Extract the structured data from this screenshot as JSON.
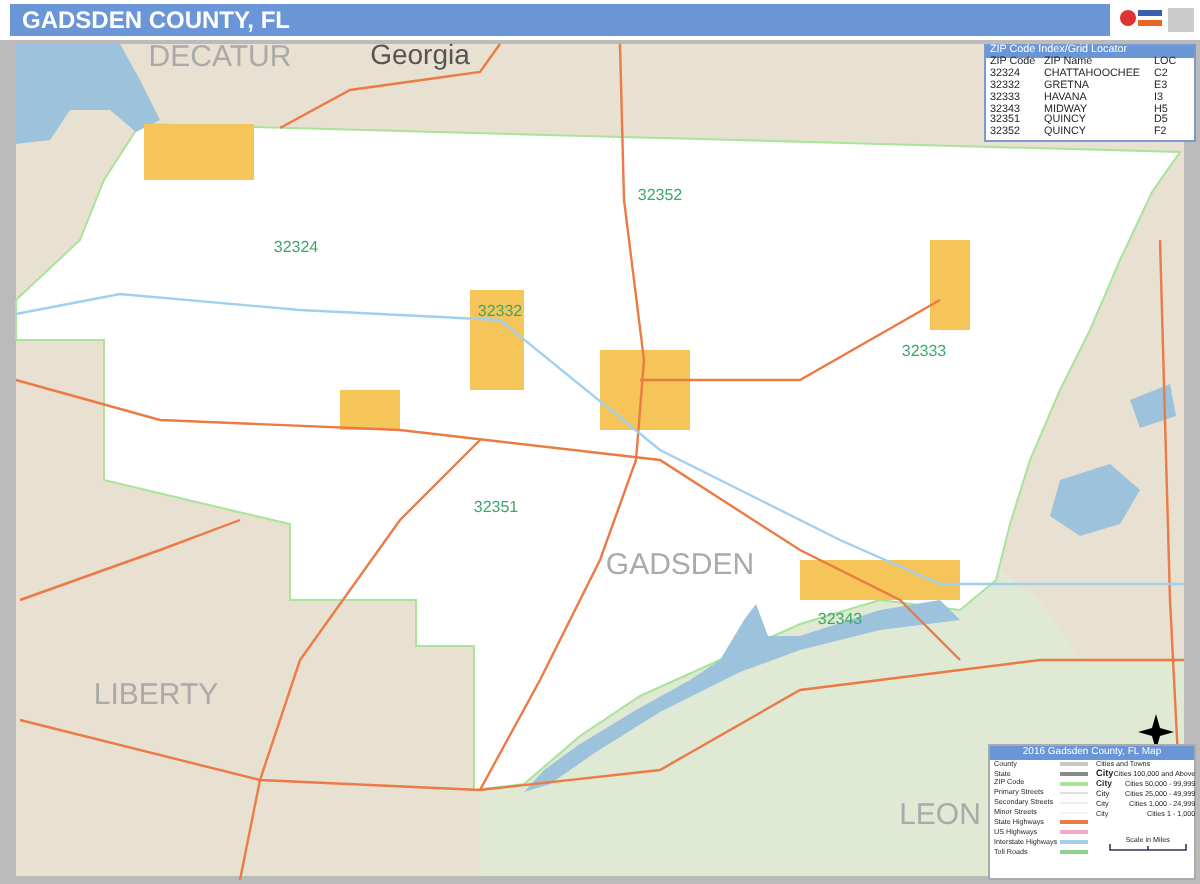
{
  "header": {
    "title": "GADSDEN COUNTY, FL"
  },
  "map_labels": [
    {
      "kind": "county",
      "text": "DECATUR"
    },
    {
      "kind": "state",
      "text": "Georgia"
    },
    {
      "kind": "zip",
      "text": "32352"
    },
    {
      "kind": "zip",
      "text": "32324"
    },
    {
      "kind": "zip",
      "text": "32332"
    },
    {
      "kind": "zip",
      "text": "32333"
    },
    {
      "kind": "zip",
      "text": "32351"
    },
    {
      "kind": "county",
      "text": "GADSDEN"
    },
    {
      "kind": "zip",
      "text": "32343"
    },
    {
      "kind": "county",
      "text": "LIBERTY"
    },
    {
      "kind": "county",
      "text": "LEON"
    }
  ],
  "zip_index": {
    "title": "ZIP Code Index/Grid Locator",
    "columns": [
      "ZIP Code",
      "ZIP Name",
      "LOC"
    ],
    "rows": [
      [
        "32324",
        "CHATTAHOOCHEE",
        "C2"
      ],
      [
        "32332",
        "GRETNA",
        "E3"
      ],
      [
        "32333",
        "HAVANA",
        "I3"
      ],
      [
        "32343",
        "MIDWAY",
        "H5"
      ],
      [
        "32351",
        "QUINCY",
        "D5"
      ],
      [
        "32352",
        "QUINCY",
        "F2"
      ]
    ]
  },
  "legend": {
    "title": "2016 Gadsden County, FL Map",
    "cities_heading": "Cities and Towns",
    "line_items": [
      {
        "label": "County",
        "color": "#c8c8c8"
      },
      {
        "label": "State",
        "color": "#8a8a8a"
      },
      {
        "label": "ZIP Code",
        "color": "#a8e49a"
      },
      {
        "label": "Primary Streets",
        "color": "#e0e0e0"
      },
      {
        "label": "Secondary Streets",
        "color": "#eeeeee"
      },
      {
        "label": "Minor Streets",
        "color": "#f4f4f4"
      },
      {
        "label": "State Highways",
        "color": "#ec7a45"
      },
      {
        "label": "US Highways",
        "color": "#f4a8c8"
      },
      {
        "label": "Interstate Highways",
        "color": "#9fd0f0"
      },
      {
        "label": "Toll Roads",
        "color": "#8fd08f"
      }
    ],
    "city_items": [
      {
        "sample": "City",
        "description": "Cities 100,000 and Above"
      },
      {
        "sample": "City",
        "description": "Cities 50,000 - 99,999"
      },
      {
        "sample": "City",
        "description": "Cities 25,000 - 49,999"
      },
      {
        "sample": "City",
        "description": "Cities 1,000 - 24,999"
      },
      {
        "sample": "City",
        "description": "Cities 1 - 1,000"
      }
    ],
    "scale_caption": "Scale in Miles"
  }
}
